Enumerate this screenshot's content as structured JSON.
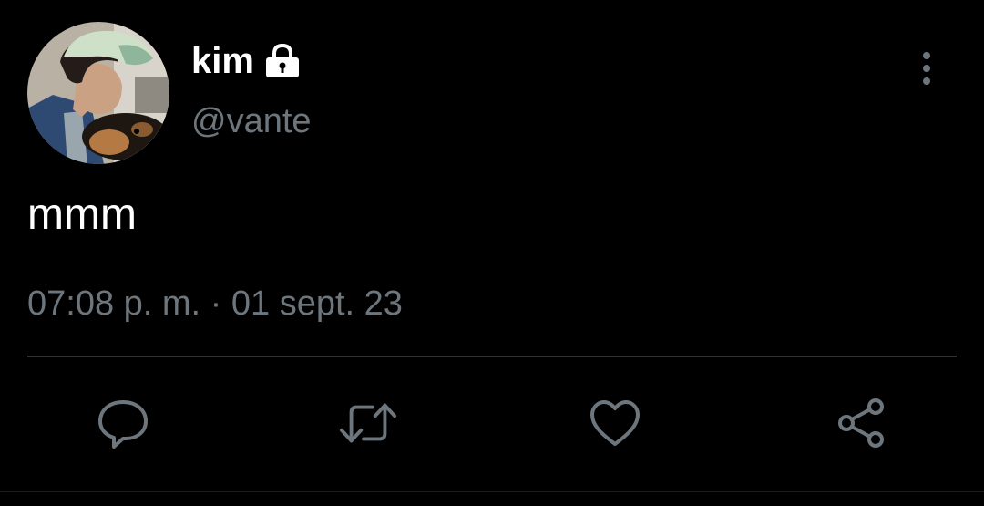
{
  "author": {
    "display_name": "kim",
    "handle": "@vante",
    "protected": true
  },
  "tweet": {
    "text": "mmm",
    "timestamp": "07:08 p. m. · 01 sept. 23"
  },
  "actions": [
    {
      "name": "reply",
      "icon": "reply-icon"
    },
    {
      "name": "retweet",
      "icon": "retweet-icon"
    },
    {
      "name": "like",
      "icon": "heart-icon"
    },
    {
      "name": "share",
      "icon": "share-icon"
    }
  ],
  "colors": {
    "background": "#000000",
    "primary_text": "#ffffff",
    "secondary_text": "#6e767d",
    "icon": "#6e767d",
    "divider": "#2f3336"
  }
}
